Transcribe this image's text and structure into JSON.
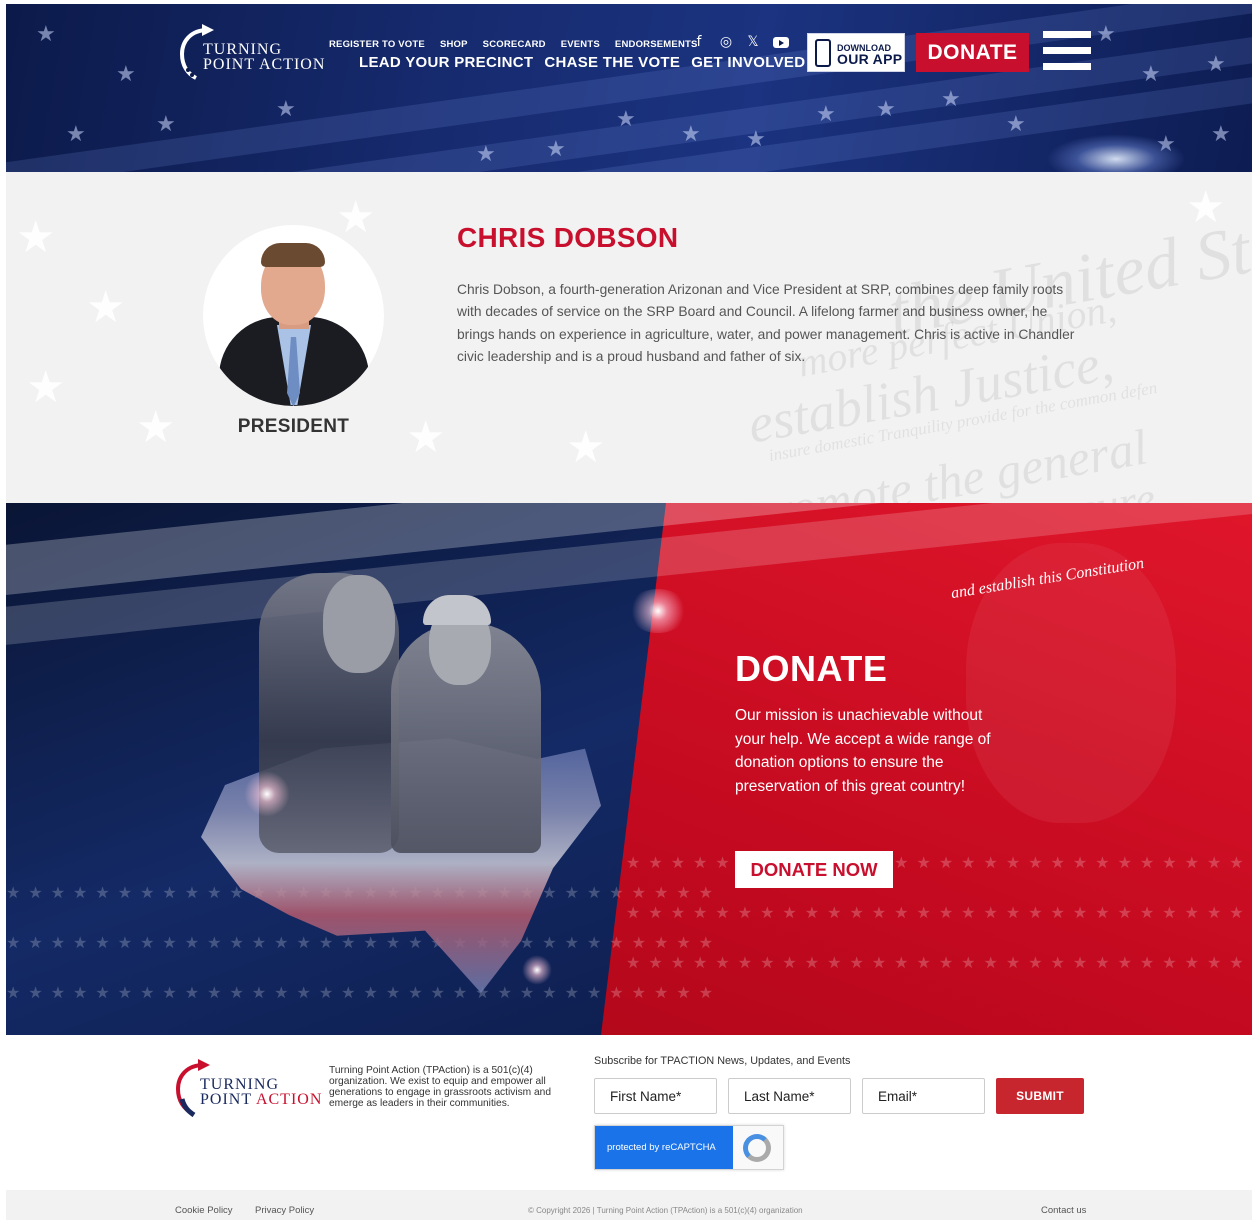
{
  "header": {
    "logo": {
      "line1": "TURNING",
      "line2": "POINT ACTION"
    },
    "top_nav": [
      "REGISTER TO VOTE",
      "SHOP",
      "SCORECARD",
      "EVENTS",
      "ENDORSEMENTS"
    ],
    "main_nav": [
      "LEAD YOUR PRECINCT",
      "CHASE THE VOTE",
      "GET INVOLVED"
    ],
    "social_icons": [
      "facebook-icon",
      "instagram-icon",
      "x-icon",
      "youtube-icon"
    ],
    "app_button": {
      "line1": "DOWNLOAD",
      "line2": "OUR APP"
    },
    "donate_button": "DONATE",
    "colors": {
      "navy": "#0c1a4a",
      "red": "#c8102e"
    }
  },
  "bio": {
    "name": "CHRIS DOBSON",
    "role": "PRESIDENT",
    "text": "Chris Dobson, a fourth-generation Arizonan and Vice President at SRP, combines deep family roots with decades of service on the SRP Board and Council. A lifelong farmer and business owner, he brings hands on experience in agriculture, water, and power management. Chris is active in Chandler civic leadership and is a proud husband and father of six.",
    "watermark_lines": [
      "the United States",
      "more perfect Union,",
      "establish Justice,",
      "insure domestic Tranquility provide for the common defen",
      "promote the general",
      "Welfare, and secure"
    ]
  },
  "donate": {
    "script": "and establish this Constitution",
    "title": "DONATE",
    "text": "Our mission is unachievable without your help. We accept a wide range of donation options to ensure the preservation of this great country!",
    "button": "DONATE NOW"
  },
  "footer": {
    "logo": {
      "line1": "TURNING",
      "line2a": "POINT ",
      "line2b": "ACTION"
    },
    "description": "Turning Point Action (TPAction) is a 501(c)(4) organization. We exist to equip and empower all generations to engage in grassroots activism and emerge as leaders in their communities.",
    "subscribe_heading": "Subscribe for TPACTION News, Updates, and Events",
    "fields": {
      "first": "First Name*",
      "last": "Last Name*",
      "email": "Email*"
    },
    "submit": "SUBMIT",
    "recaptcha": "protected by reCAPTCHA"
  },
  "bottom_bar": {
    "cookie": "Cookie Policy",
    "privacy": "Privacy Policy",
    "copyright": "© Copyright 2026 | Turning Point Action (TPAction) is a 501(c)(4) organization",
    "contact": "Contact us"
  }
}
